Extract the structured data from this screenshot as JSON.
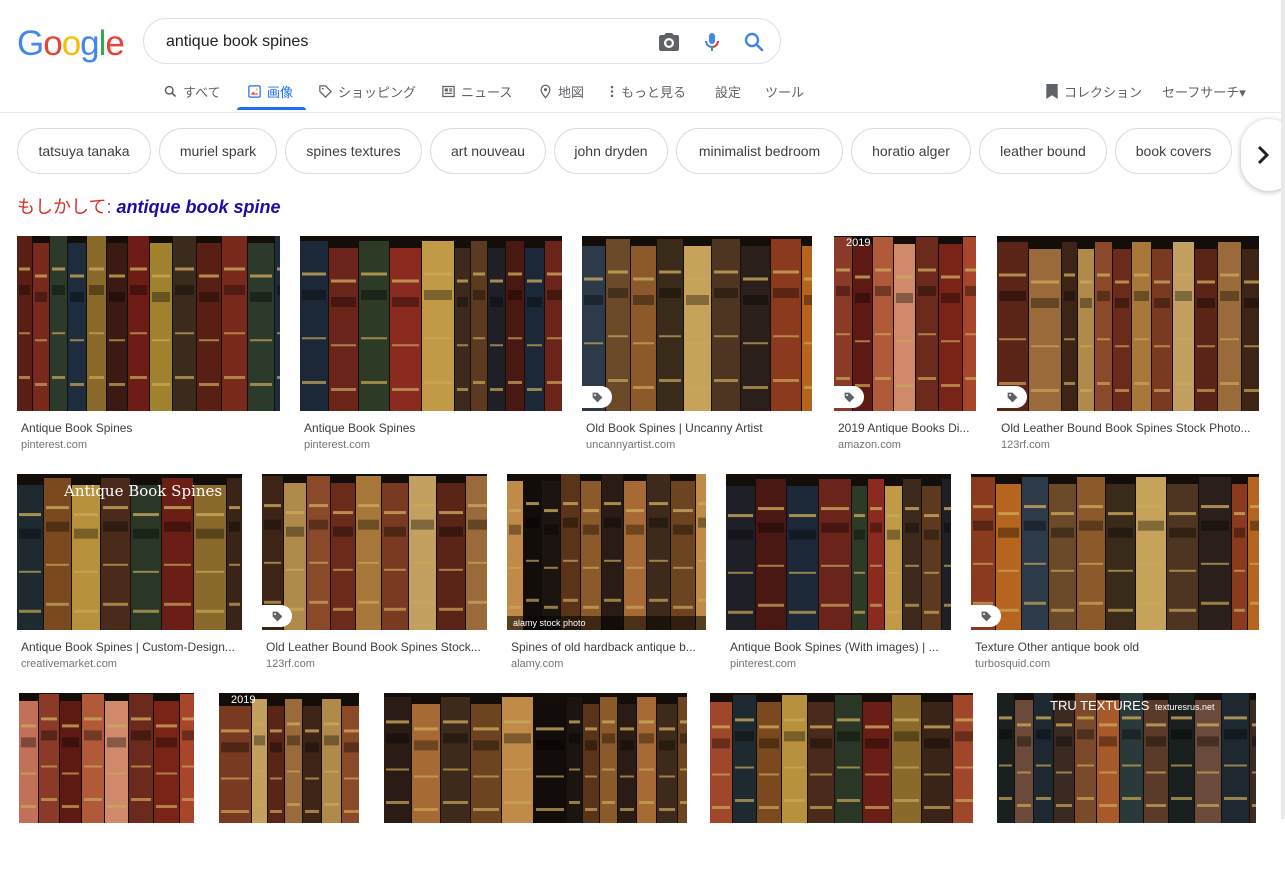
{
  "logo": {
    "letters": [
      "G",
      "o",
      "o",
      "g",
      "l",
      "e"
    ],
    "colors": [
      "#4285f4",
      "#ea4335",
      "#fbbc05",
      "#4285f4",
      "#34a853",
      "#ea4335"
    ]
  },
  "search": {
    "value": "antique book spines",
    "camera_icon": "camera-icon",
    "mic_icon": "mic-icon",
    "search_icon": "search-icon"
  },
  "tabs": [
    {
      "label": "すべて",
      "icon": "search-icon"
    },
    {
      "label": "画像",
      "icon": "image-icon"
    },
    {
      "label": "ショッピング",
      "icon": "tag-icon"
    },
    {
      "label": "ニュース",
      "icon": "news-icon"
    },
    {
      "label": "地図",
      "icon": "map-pin-icon"
    },
    {
      "label": "もっと見る",
      "icon": "more-vert-icon"
    },
    {
      "label": "設定"
    },
    {
      "label": "ツール"
    }
  ],
  "right_tools": {
    "collection": "コレクション",
    "safesearch": "セーフサーチ▾"
  },
  "chips": [
    "tatsuya tanaka",
    "muriel spark",
    "spines textures",
    "art nouveau",
    "john dryden",
    "minimalist bedroom",
    "horatio alger",
    "leather bound",
    "book covers"
  ],
  "did_you_mean": {
    "prefix": "もしかして: ",
    "suggestion": "antique book spine"
  },
  "results": [
    {
      "title": "Antique Book Spines",
      "source": "pinterest.com"
    },
    {
      "title": "Antique Book Spines",
      "source": "pinterest.com"
    },
    {
      "title": "Old Book Spines | Uncanny Artist",
      "source": "uncannyartist.com"
    },
    {
      "title": "2019 Antique Books Di...",
      "source": "amazon.com",
      "overlay": "2019"
    },
    {
      "title": "Old Leather Bound Book Spines Stock Photo...",
      "source": "123rf.com"
    },
    {
      "title": "Antique Book Spines | Custom-Design...",
      "source": "creativemarket.com",
      "overlay": "Antique Book Spines"
    },
    {
      "title": "Old Leather Bound Book Spines Stock...",
      "source": "123rf.com"
    },
    {
      "title": "Spines of old hardback antique b...",
      "source": "alamy.com",
      "overlay": "alamy stock photo"
    },
    {
      "title": "Antique Book Spines (With images) | ...",
      "source": "pinterest.com"
    },
    {
      "title": "Texture Other antique book old",
      "source": "turbosquid.com"
    },
    {
      "title": "",
      "source": ""
    },
    {
      "title": "",
      "source": "",
      "overlay": "2019"
    },
    {
      "title": "",
      "source": ""
    },
    {
      "title": "",
      "source": ""
    },
    {
      "title": "",
      "source": "",
      "overlay": "TRU TEXTURES",
      "overlay2": "texturesrus.net"
    }
  ],
  "colors": {
    "accent": "#1a73e8",
    "link": "#1a0dab",
    "dym_red": "#d93025"
  }
}
